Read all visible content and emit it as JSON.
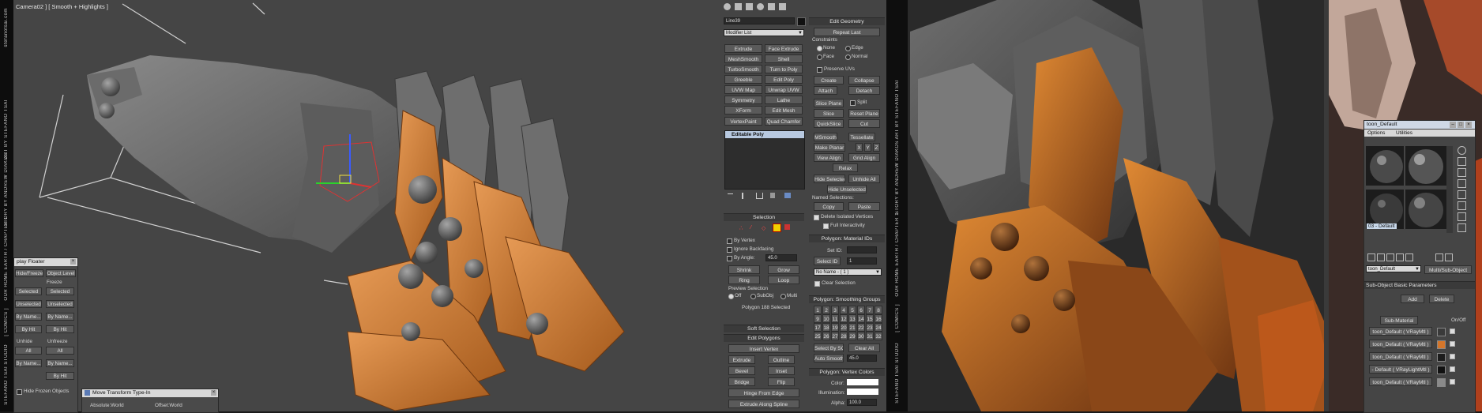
{
  "viewport": {
    "label": "Camera02 ] [ Smooth + Highlights ]",
    "side_text": [
      "STEFANO TSAI STUDIO",
      "[ COMICS ]",
      "OUR HOME EARTH / CHAPTER 1",
      "STORY BY ANDREW DIAKOS",
      "ART BY STEFANO TSAI",
      "stefanotsai.com"
    ]
  },
  "command_panel": {
    "object_name": "Line39",
    "modifier_list": "Modifier List",
    "modifier_buttons": [
      "Extrude",
      "Face Extrude",
      "MeshSmooth",
      "Shell",
      "TurboSmooth",
      "Turn to Poly",
      "Greeble",
      "Edit Poly",
      "UVW Map",
      "Unwrap UVW",
      "Symmetry",
      "Lathe",
      "XForm",
      "Edit Mesh",
      "VertexPaint",
      "Quad Chamfer"
    ],
    "stack_item": "Editable Poly",
    "selection": {
      "title": "Selection",
      "by_vertex": "By Vertex",
      "ignore_backfacing": "Ignore Backfacing",
      "by_angle": "By Angle:",
      "by_angle_value": "45.0",
      "shrink": "Shrink",
      "grow": "Grow",
      "ring": "Ring",
      "loop": "Loop",
      "preview_selection": "Preview Selection",
      "preview_options": [
        "Off",
        "SubObj",
        "Multi"
      ],
      "status": "Polygon 188 Selected"
    },
    "soft_selection": "Soft Selection",
    "edit_polygons": {
      "title": "Edit Polygons",
      "insert_vertex": "Insert Vertex",
      "buttons": [
        "Extrude",
        "Outline",
        "Bevel",
        "Inset",
        "Bridge",
        "Flip"
      ],
      "hinge": "Hinge From Edge",
      "extrude_spline": "Extrude Along Spline"
    },
    "edit_geometry": {
      "title": "Edit Geometry",
      "repeat_last": "Repeat Last",
      "constraints": "Constraints",
      "constraint_options": [
        "None",
        "Edge",
        "Face",
        "Normal"
      ],
      "preserve_uvs": "Preserve UVs",
      "create": "Create",
      "collapse": "Collapse",
      "attach": "Attach",
      "detach": "Detach",
      "slice_plane": "Slice Plane",
      "split": "Split",
      "slice": "Slice",
      "reset_plane": "Reset Plane",
      "quickslice": "QuickSlice",
      "cut": "Cut",
      "msmooth": "MSmooth",
      "tessellate": "Tessellate",
      "make_planar": "Make Planar",
      "axes": [
        "X",
        "Y",
        "Z"
      ],
      "view_align": "View Align",
      "grid_align": "Grid Align",
      "relax": "Relax",
      "hide_selected": "Hide Selected",
      "unhide_all": "Unhide All",
      "hide_unselected": "Hide Unselected",
      "named_selections": "Named Selections:",
      "copy": "Copy",
      "paste": "Paste",
      "delete_isolated": "Delete Isolated Vertices",
      "full_interactivity": "Full Interactivity"
    },
    "material_ids": {
      "title": "Polygon: Material IDs",
      "set_id": "Set ID:",
      "select_id": "Select ID",
      "select_id_value": "1",
      "name_dropdown": "No Name - ( 1 )",
      "clear_selection": "Clear Selection"
    },
    "smoothing_groups": {
      "title": "Polygon: Smoothing Groups",
      "numbers": [
        "1",
        "2",
        "3",
        "4",
        "5",
        "6",
        "7",
        "8",
        "9",
        "10",
        "11",
        "12",
        "13",
        "14",
        "15",
        "16",
        "17",
        "18",
        "19",
        "20",
        "21",
        "22",
        "23",
        "24",
        "25",
        "26",
        "27",
        "28",
        "29",
        "30",
        "31",
        "32"
      ],
      "select_by_sg": "Select By SG",
      "clear_all": "Clear All",
      "auto_smooth": "Auto Smooth",
      "auto_smooth_value": "45.0"
    },
    "vertex_colors": {
      "title": "Polygon: Vertex Colors",
      "color": "Color:",
      "illumination": "Illumination:",
      "alpha": "Alpha:",
      "alpha_value": "100.0"
    }
  },
  "display_floater": {
    "title": "play Floater",
    "hide_freeze": "Hide/Freeze",
    "object_level": "Object Level",
    "hide": "Hide",
    "freeze": "Freeze",
    "selected": "Selected",
    "unselected": "Unselected",
    "by_name": "By Name...",
    "by_hit": "By Hit",
    "unhide": "Unhide",
    "unfreeze": "Unfreeze",
    "all": "All",
    "hide_frozen": "Hide Frozen Objects"
  },
  "move_transform": {
    "title": "Move Transform Type-In",
    "absolute": "Absolute:World",
    "offset": "Offset:World"
  },
  "material_editor": {
    "title": "toon_Default",
    "menu": [
      "Options",
      "Utilities"
    ],
    "slot_name": "03 - Default",
    "material_name": "toon_Default",
    "type_button": "Multi/Sub-Object",
    "params_title": "Sub-Object Basic Parameters",
    "add": "Add",
    "delete": "Delete",
    "sub_material": "Sub-Material",
    "on_off": "On/Off",
    "rows": [
      "toon_Default ( VRayMtl )",
      "toon_Default ( VRayMtl )",
      "toon_Default ( VRayMtl )",
      "- Default ( VRayLightMtl )",
      "toon_Default ( VRayMtl )"
    ],
    "row_colors": [
      "#3a3a3a",
      "#d4762b",
      "#1c1c1c",
      "#111111",
      "#8a8a8a"
    ]
  },
  "render_view": {
    "side_text": [
      "STEFANO TSAI STUDIO",
      "[ COMICS ]",
      "OUR HOME EARTH / CHAPTER 1",
      "STORY BY ANDREW DIAKOS",
      "ART BY STEFANO TSAI"
    ]
  }
}
